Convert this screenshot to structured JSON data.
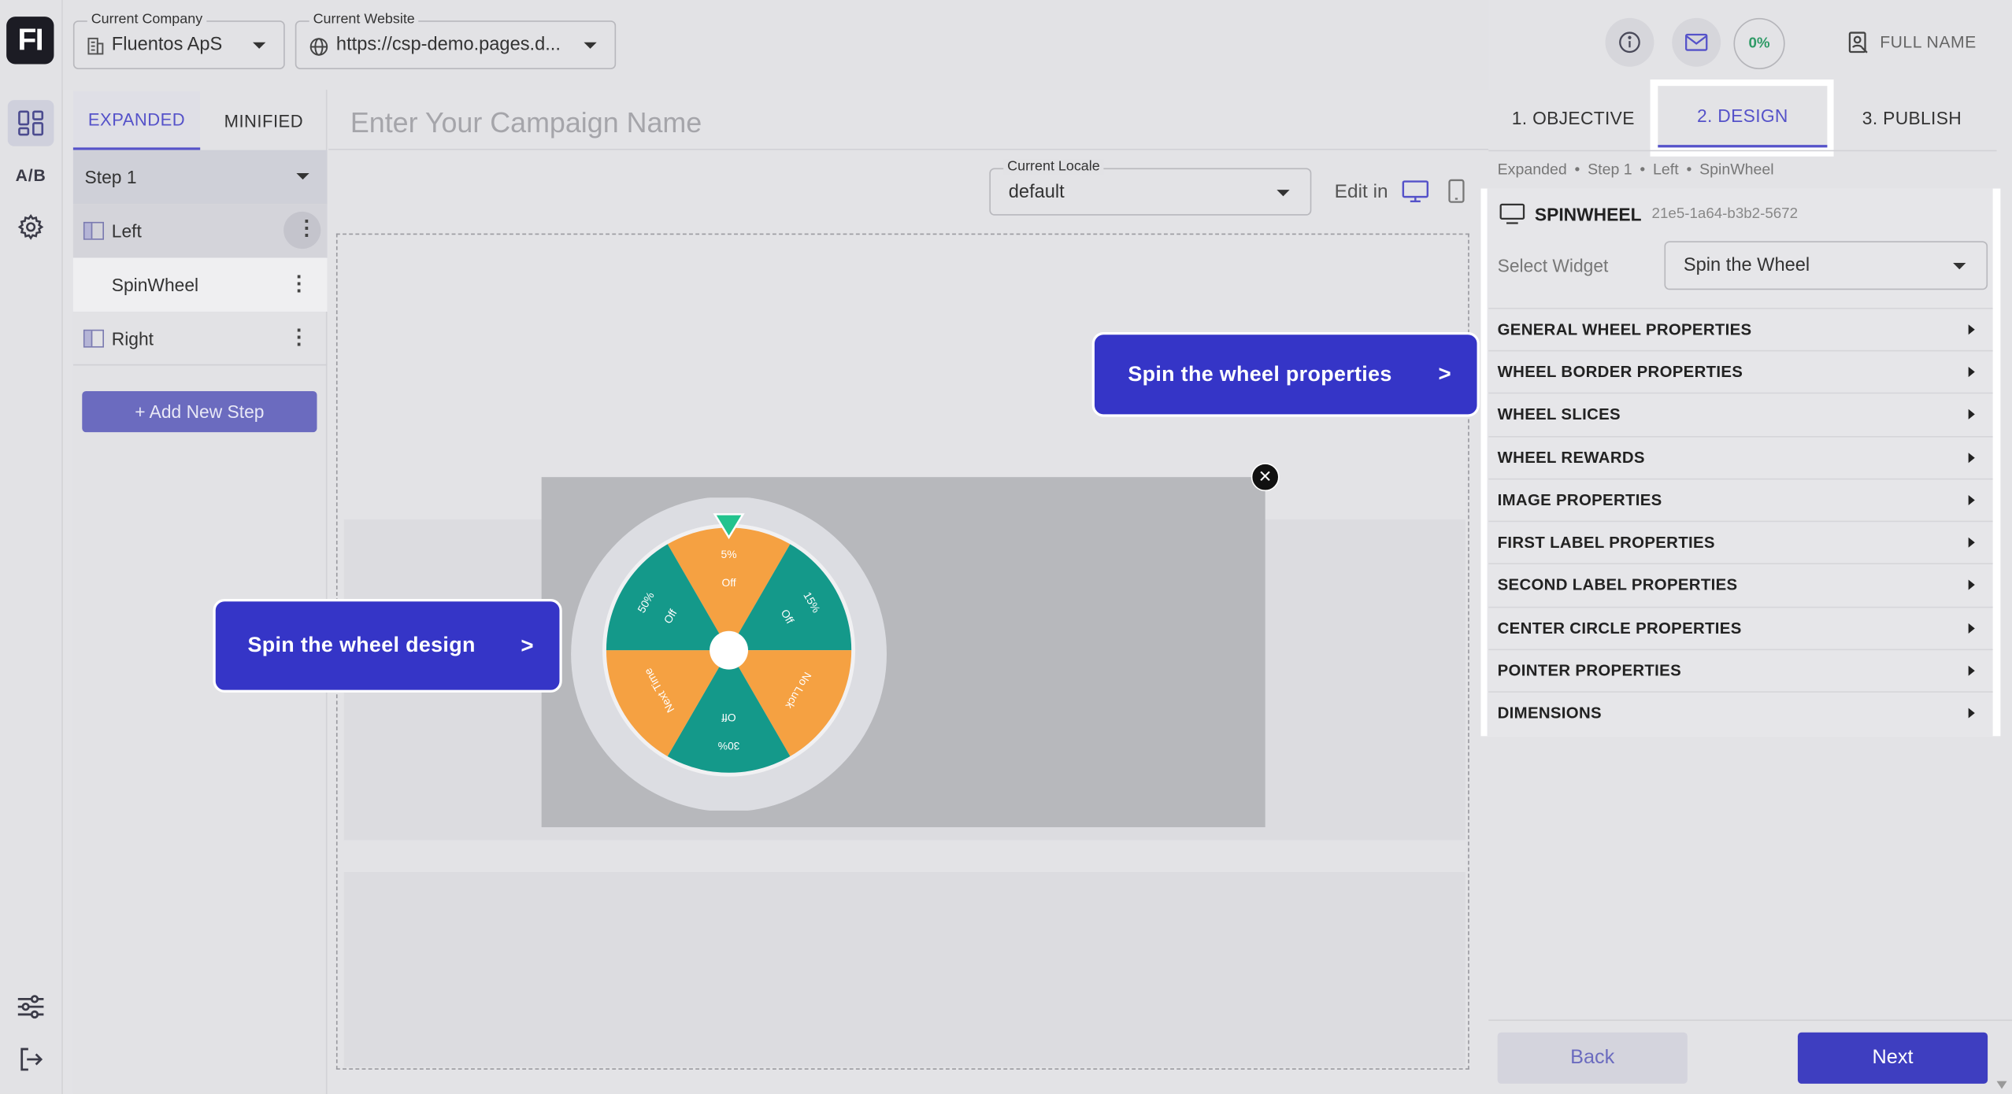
{
  "rail": {
    "logo": "FI",
    "ab_label": "A/B"
  },
  "topbar": {
    "company": {
      "label": "Current Company",
      "value": "Fluentos ApS"
    },
    "website": {
      "label": "Current Website",
      "value": "https://csp-demo.pages.d..."
    }
  },
  "steps_panel": {
    "tabs": [
      "EXPANDED",
      "MINIFIED"
    ],
    "step_select": "Step 1",
    "rows": [
      {
        "label": "Left"
      },
      {
        "label": "SpinWheel"
      },
      {
        "label": "Right"
      }
    ],
    "add_step": "+ Add New Step"
  },
  "main": {
    "campaign_placeholder": "Enter Your Campaign Name",
    "locale": {
      "label": "Current Locale",
      "value": "default"
    },
    "edit_in": "Edit in",
    "close_glyph": "✕",
    "callout_props": {
      "text": "Spin the wheel properties",
      "arrow": ">"
    },
    "callout_design": {
      "text": "Spin the wheel design",
      "arrow": ">"
    }
  },
  "wheel": {
    "colors": {
      "orange": "#f5a142",
      "teal": "#14998a",
      "ring": "#dcdde2",
      "pointer": "#22c38e"
    },
    "slices": [
      {
        "line1": "5%",
        "line2": "Off"
      },
      {
        "line1": "15%",
        "line2": "Off"
      },
      {
        "line1": "No Luck",
        "line2": ""
      },
      {
        "line1": "30%",
        "line2": "Off"
      },
      {
        "line1": "Next Time",
        "line2": ""
      },
      {
        "line1": "50%",
        "line2": "Off"
      }
    ]
  },
  "right_panel": {
    "progress": "0%",
    "full_name": "FULL NAME",
    "tabs": [
      "1. OBJECTIVE",
      "2. DESIGN",
      "3. PUBLISH"
    ],
    "breadcrumb": [
      "Expanded",
      "Step 1",
      "Left",
      "SpinWheel"
    ],
    "widget_title": "SPINWHEEL",
    "widget_id": "21e5-1a64-b3b2-5672",
    "select_widget_label": "Select Widget",
    "select_widget_value": "Spin the Wheel",
    "sections": [
      "GENERAL WHEEL PROPERTIES",
      "WHEEL BORDER PROPERTIES",
      "WHEEL SLICES",
      "WHEEL REWARDS",
      "IMAGE PROPERTIES",
      "FIRST LABEL PROPERTIES",
      "SECOND LABEL PROPERTIES",
      "CENTER CIRCLE PROPERTIES",
      "POINTER PROPERTIES",
      "DIMENSIONS"
    ],
    "back": "Back",
    "next": "Next"
  },
  "theme": {
    "accent": "#5552c9",
    "callout": "#3535c7",
    "primary_button": "#3e3ec0"
  }
}
